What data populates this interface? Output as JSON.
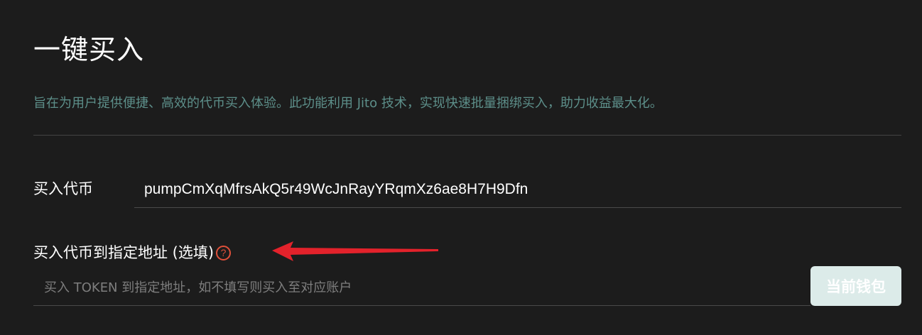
{
  "page": {
    "title": "一键买入",
    "description": "旨在为用户提供便捷、高效的代币买入体验。此功能利用 Jito 技术，实现快速批量捆绑买入，助力收益最大化。"
  },
  "token_field": {
    "label": "买入代币",
    "value": "pumpCmXqMfrsAkQ5r49WcJnRayYRqmXz6ae8H7H9Dfn"
  },
  "address_field": {
    "label": "买入代币到指定地址 (选填)",
    "help_icon": "question-circle-icon",
    "placeholder": "买入 TOKEN 到指定地址，如不填写则买入至对应账户",
    "button_label": "当前钱包"
  },
  "colors": {
    "background": "#1c1c1c",
    "description": "#5d8f8a",
    "help_icon": "#e0503a",
    "annotation_arrow": "#e3222b",
    "button_bg": "#dcebe9"
  }
}
